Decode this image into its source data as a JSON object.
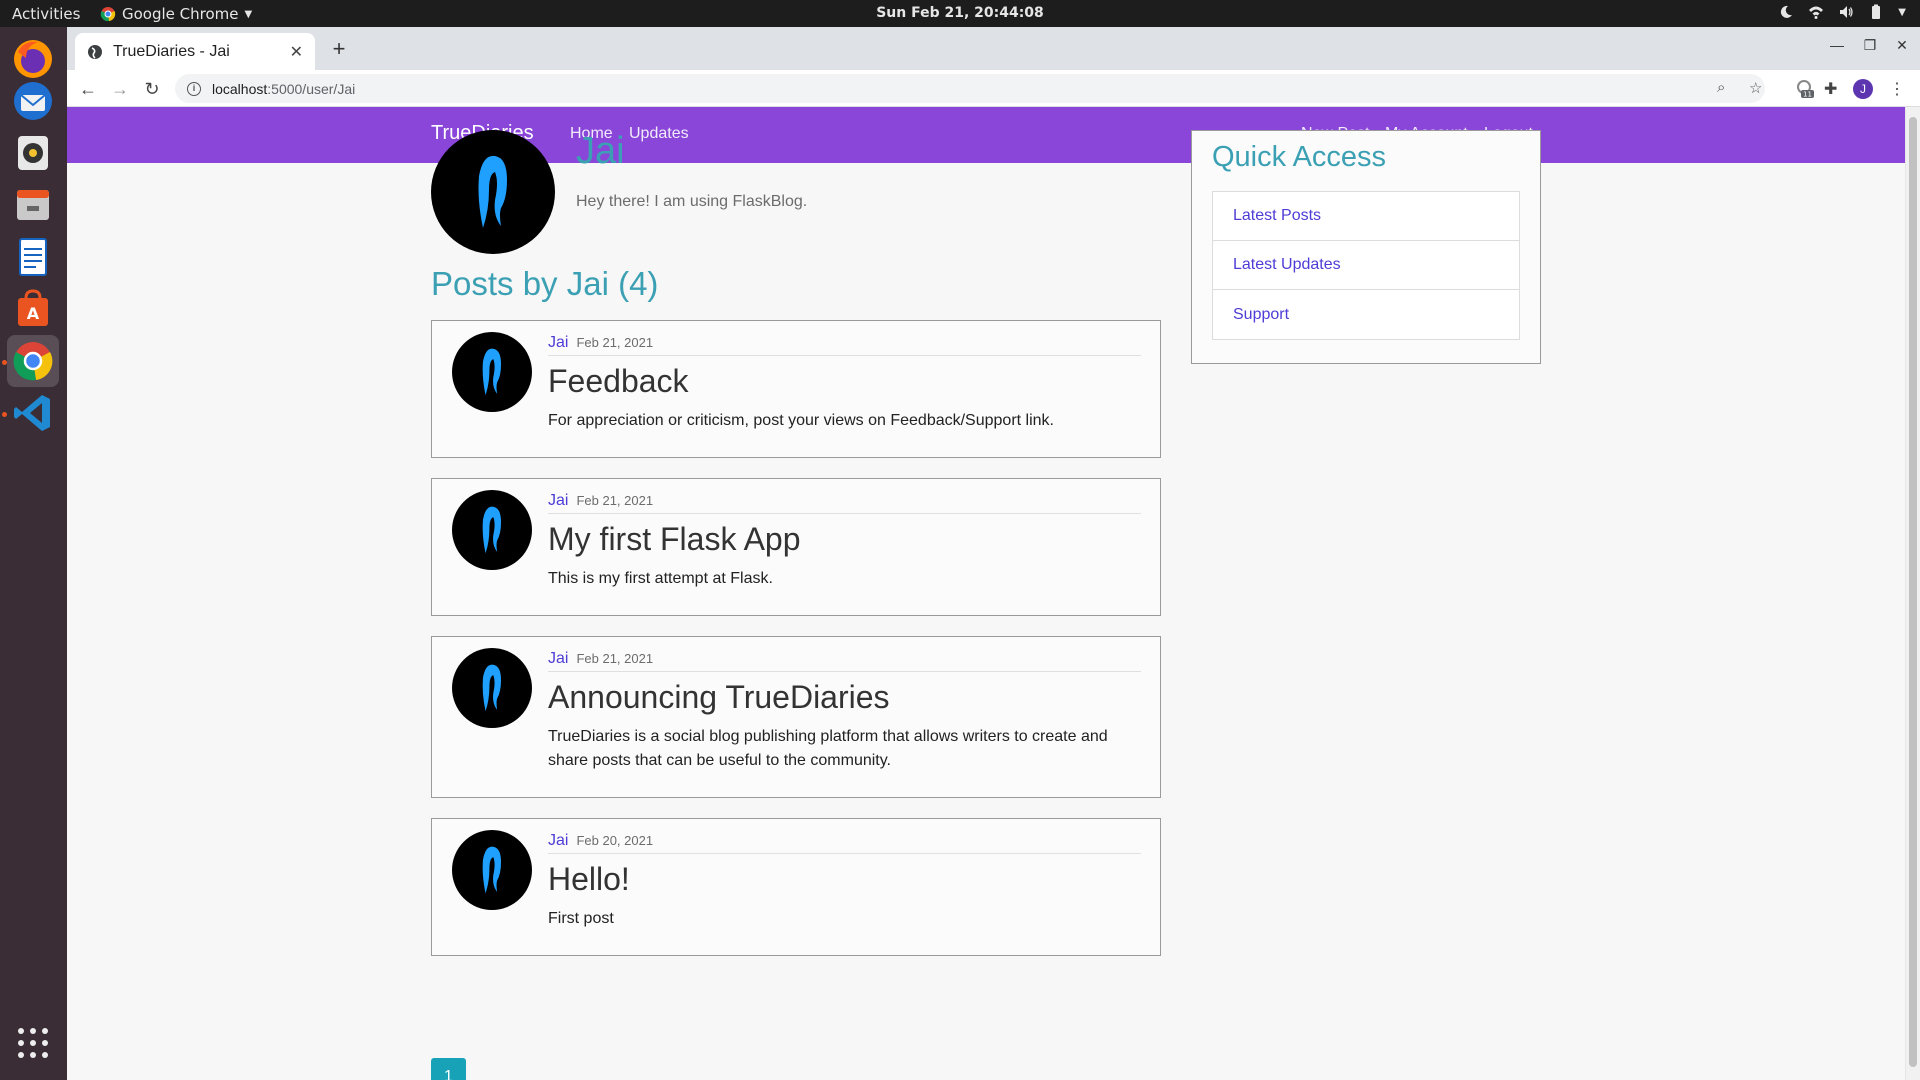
{
  "system": {
    "activities": "Activities",
    "app_name": "Google Chrome",
    "clock": "Sun Feb 21, 20:44:08"
  },
  "browser": {
    "tab_title": "TrueDiaries - Jai",
    "url_host": "localhost",
    "url_path": ":5000/user/Jai",
    "extension_badge": "11",
    "profile_initial": "J"
  },
  "navbar": {
    "brand": "TrueDiaries",
    "left_links": [
      "Home",
      "Updates"
    ],
    "right_links": [
      "New Post",
      "My Account",
      "Logout"
    ],
    "color": "#8a45d9"
  },
  "profile": {
    "username": "Jai",
    "about": "Hey there! I am using FlaskBlog."
  },
  "posts_heading": "Posts by Jai (4)",
  "posts": [
    {
      "author": "Jai",
      "date": "Feb 21, 2021",
      "title": "Feedback",
      "body": "For appreciation or criticism, post your views on Feedback/Support link."
    },
    {
      "author": "Jai",
      "date": "Feb 21, 2021",
      "title": "My first Flask App",
      "body": "This is my first attempt at Flask."
    },
    {
      "author": "Jai",
      "date": "Feb 21, 2021",
      "title": "Announcing TrueDiaries",
      "body": "TrueDiaries is a social blog publishing platform that allows writers to create and share posts that can be useful to the community."
    },
    {
      "author": "Jai",
      "date": "Feb 20, 2021",
      "title": "Hello!",
      "body": "First post"
    }
  ],
  "pagination": {
    "current_page": "1"
  },
  "sidebar": {
    "heading": "Quick Access",
    "items": [
      "Latest Posts",
      "Latest Updates",
      "Support"
    ]
  },
  "colors": {
    "accent_teal": "#3ba0b3",
    "link": "#4d3dd6",
    "page_button": "#17a2b8"
  }
}
